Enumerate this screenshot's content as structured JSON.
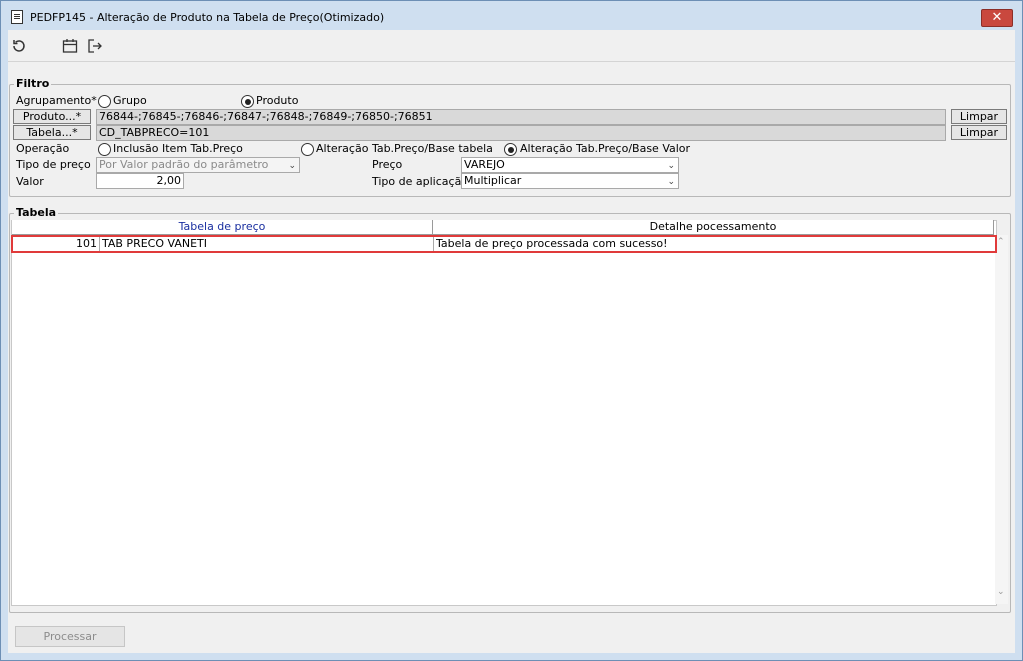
{
  "window": {
    "title": "PEDFP145 - Alteração de Produto na Tabela de Preço(Otimizado)",
    "close_label": "✕"
  },
  "toolbar": {
    "refresh_icon": "refresh-icon",
    "calendar_icon": "calendar-icon",
    "exit_icon": "exit-icon"
  },
  "filtro": {
    "legend": "Filtro",
    "agrupamento_label": "Agrupamento*",
    "agrupamento_options": [
      "Grupo",
      "Produto"
    ],
    "agrupamento_selected": "Produto",
    "produto_button": "Produto...*",
    "produto_value": "76844-;76845-;76846-;76847-;76848-;76849-;76850-;76851",
    "tabela_button": "Tabela...*",
    "tabela_value": "CD_TABPRECO=101",
    "limpar_label": "Limpar",
    "operacao_label": "Operação",
    "operacao_options": [
      "Inclusão Item Tab.Preço",
      "Alteração Tab.Preço/Base tabela",
      "Alteração Tab.Preço/Base Valor"
    ],
    "operacao_selected": "Alteração Tab.Preço/Base Valor",
    "tipo_preco_label": "Tipo de preço",
    "tipo_preco_value": "Por Valor padrão do parâmetro",
    "preco_label": "Preço",
    "preco_value": "VAREJO",
    "valor_label": "Valor",
    "valor_value": "2,00",
    "tipo_aplicacao_label": "Tipo de aplicação",
    "tipo_aplicacao_value": "Multiplicar"
  },
  "tabela": {
    "legend": "Tabela",
    "columns": [
      "Tabela de preço",
      "Detalhe pocessamento"
    ],
    "rows": [
      {
        "codigo": "101",
        "nome": "TAB PRECO VANETI",
        "detalhe": "Tabela de preço processada com sucesso!"
      }
    ]
  },
  "footer": {
    "processar_label": "Processar"
  },
  "colors": {
    "title_bg": "#cfdff0",
    "close_bg": "#c9483e",
    "highlight": "#e03a3a",
    "header_text": "#1a2fa0"
  }
}
